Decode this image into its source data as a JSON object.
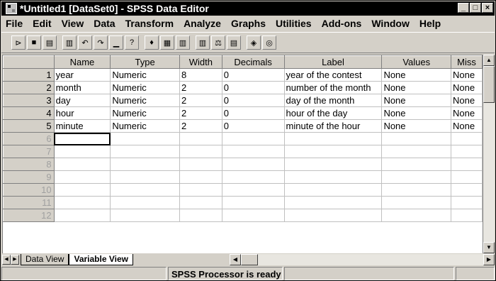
{
  "window": {
    "title": "*Untitled1 [DataSet0] - SPSS Data Editor",
    "buttons": [
      "_",
      "□",
      "×"
    ]
  },
  "menu": [
    {
      "label": "File"
    },
    {
      "label": "Edit"
    },
    {
      "label": "View"
    },
    {
      "label": "Data"
    },
    {
      "label": "Transform"
    },
    {
      "label": "Analyze"
    },
    {
      "label": "Graphs"
    },
    {
      "label": "Utilities"
    },
    {
      "label": "Add-ons"
    },
    {
      "label": "Window"
    },
    {
      "label": "Help"
    }
  ],
  "toolbar": {
    "icons": [
      "open-icon",
      "save-icon",
      "print-icon",
      "dialog-recall-icon",
      "undo-icon",
      "redo-icon",
      "goto-case-icon",
      "variables-icon",
      "find-icon",
      "insert-cases-icon",
      "insert-variable-icon",
      "split-file-icon",
      "weight-cases-icon",
      "select-cases-icon",
      "value-labels-icon",
      "use-sets-icon"
    ],
    "glyphs": [
      "⊳",
      "■",
      "▤",
      "▥",
      "↶",
      "↷",
      "▁",
      "?",
      "♦",
      "▦",
      "▥",
      "▥",
      "⚖",
      "▤",
      "◈",
      "◎"
    ]
  },
  "grid": {
    "columns": [
      "Name",
      "Type",
      "Width",
      "Decimals",
      "Label",
      "Values",
      "Miss"
    ],
    "rows": [
      {
        "num": "1",
        "name": "year",
        "type": "Numeric",
        "width": "8",
        "decimals": "0",
        "label": "year of the contest",
        "values": "None",
        "missing": "None"
      },
      {
        "num": "2",
        "name": "month",
        "type": "Numeric",
        "width": "2",
        "decimals": "0",
        "label": "number of the month",
        "values": "None",
        "missing": "None"
      },
      {
        "num": "3",
        "name": "day",
        "type": "Numeric",
        "width": "2",
        "decimals": "0",
        "label": "day of the month",
        "values": "None",
        "missing": "None"
      },
      {
        "num": "4",
        "name": "hour",
        "type": "Numeric",
        "width": "2",
        "decimals": "0",
        "label": "hour of the day",
        "values": "None",
        "missing": "None"
      },
      {
        "num": "5",
        "name": "minute",
        "type": "Numeric",
        "width": "2",
        "decimals": "0",
        "label": "minute of the hour",
        "values": "None",
        "missing": "None"
      }
    ],
    "empty_rows": [
      "6",
      "7",
      "8",
      "9",
      "10",
      "11",
      "12"
    ]
  },
  "tabs": {
    "data_view": "Data View",
    "variable_view": "Variable View"
  },
  "status": {
    "processor": "SPSS Processor is ready"
  }
}
